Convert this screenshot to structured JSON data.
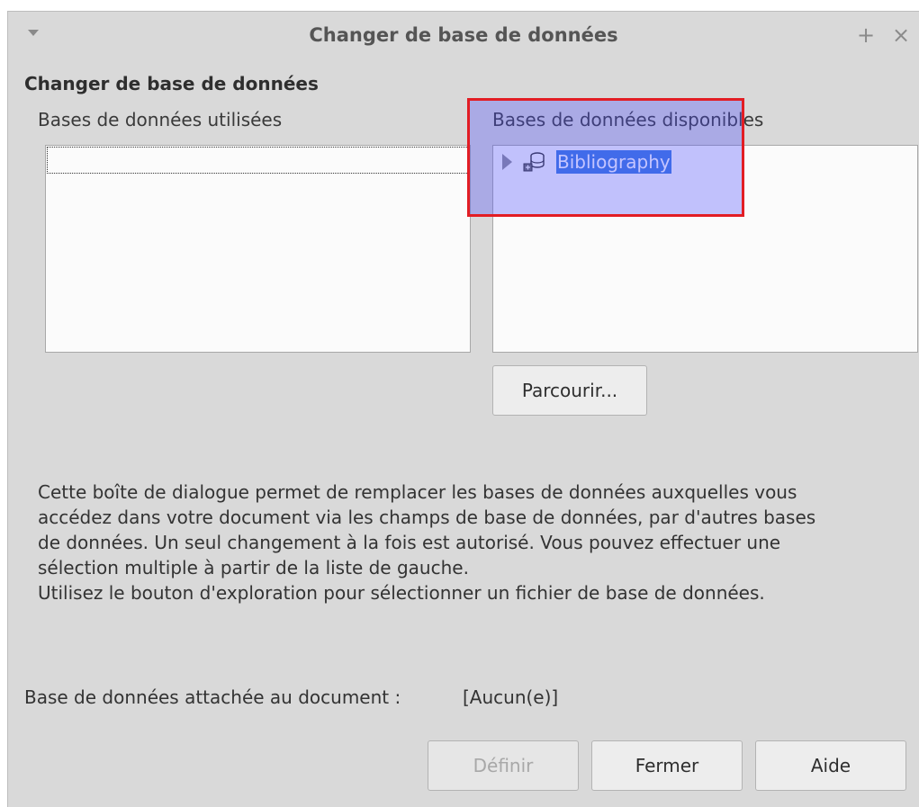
{
  "window": {
    "title": "Changer de base de données",
    "maximize_symbol": "+",
    "close_symbol": "×"
  },
  "dialog": {
    "heading": "Changer de base de données",
    "used_label": "Bases de données utilisées",
    "available_label": "Bases de données disponibles",
    "available_items": [
      {
        "label": "Bibliography",
        "icon": "database-icon",
        "selected": true
      }
    ],
    "browse_button": "Parcourir...",
    "description_lines": [
      "Cette boîte de dialogue permet de remplacer les bases de données auxquelles vous",
      "accédez dans votre document via les champs de base de données, par d'autres bases",
      "de données. Un seul changement à la fois est autorisé. Vous pouvez effectuer une",
      "sélection multiple à partir de la liste de gauche.",
      "Utilisez le bouton d'exploration pour sélectionner un fichier de base de données."
    ],
    "attached_label": "Base de données attachée au document :",
    "attached_value": "[Aucun(e)]"
  },
  "buttons": {
    "define": "Définir",
    "close": "Fermer",
    "help": "Aide"
  },
  "colors": {
    "dialog_background": "#d9d9d9",
    "selection": "#3f7de0",
    "highlight_border": "#e21d24",
    "highlight_fill": "rgba(70,70,255,0.32)"
  }
}
